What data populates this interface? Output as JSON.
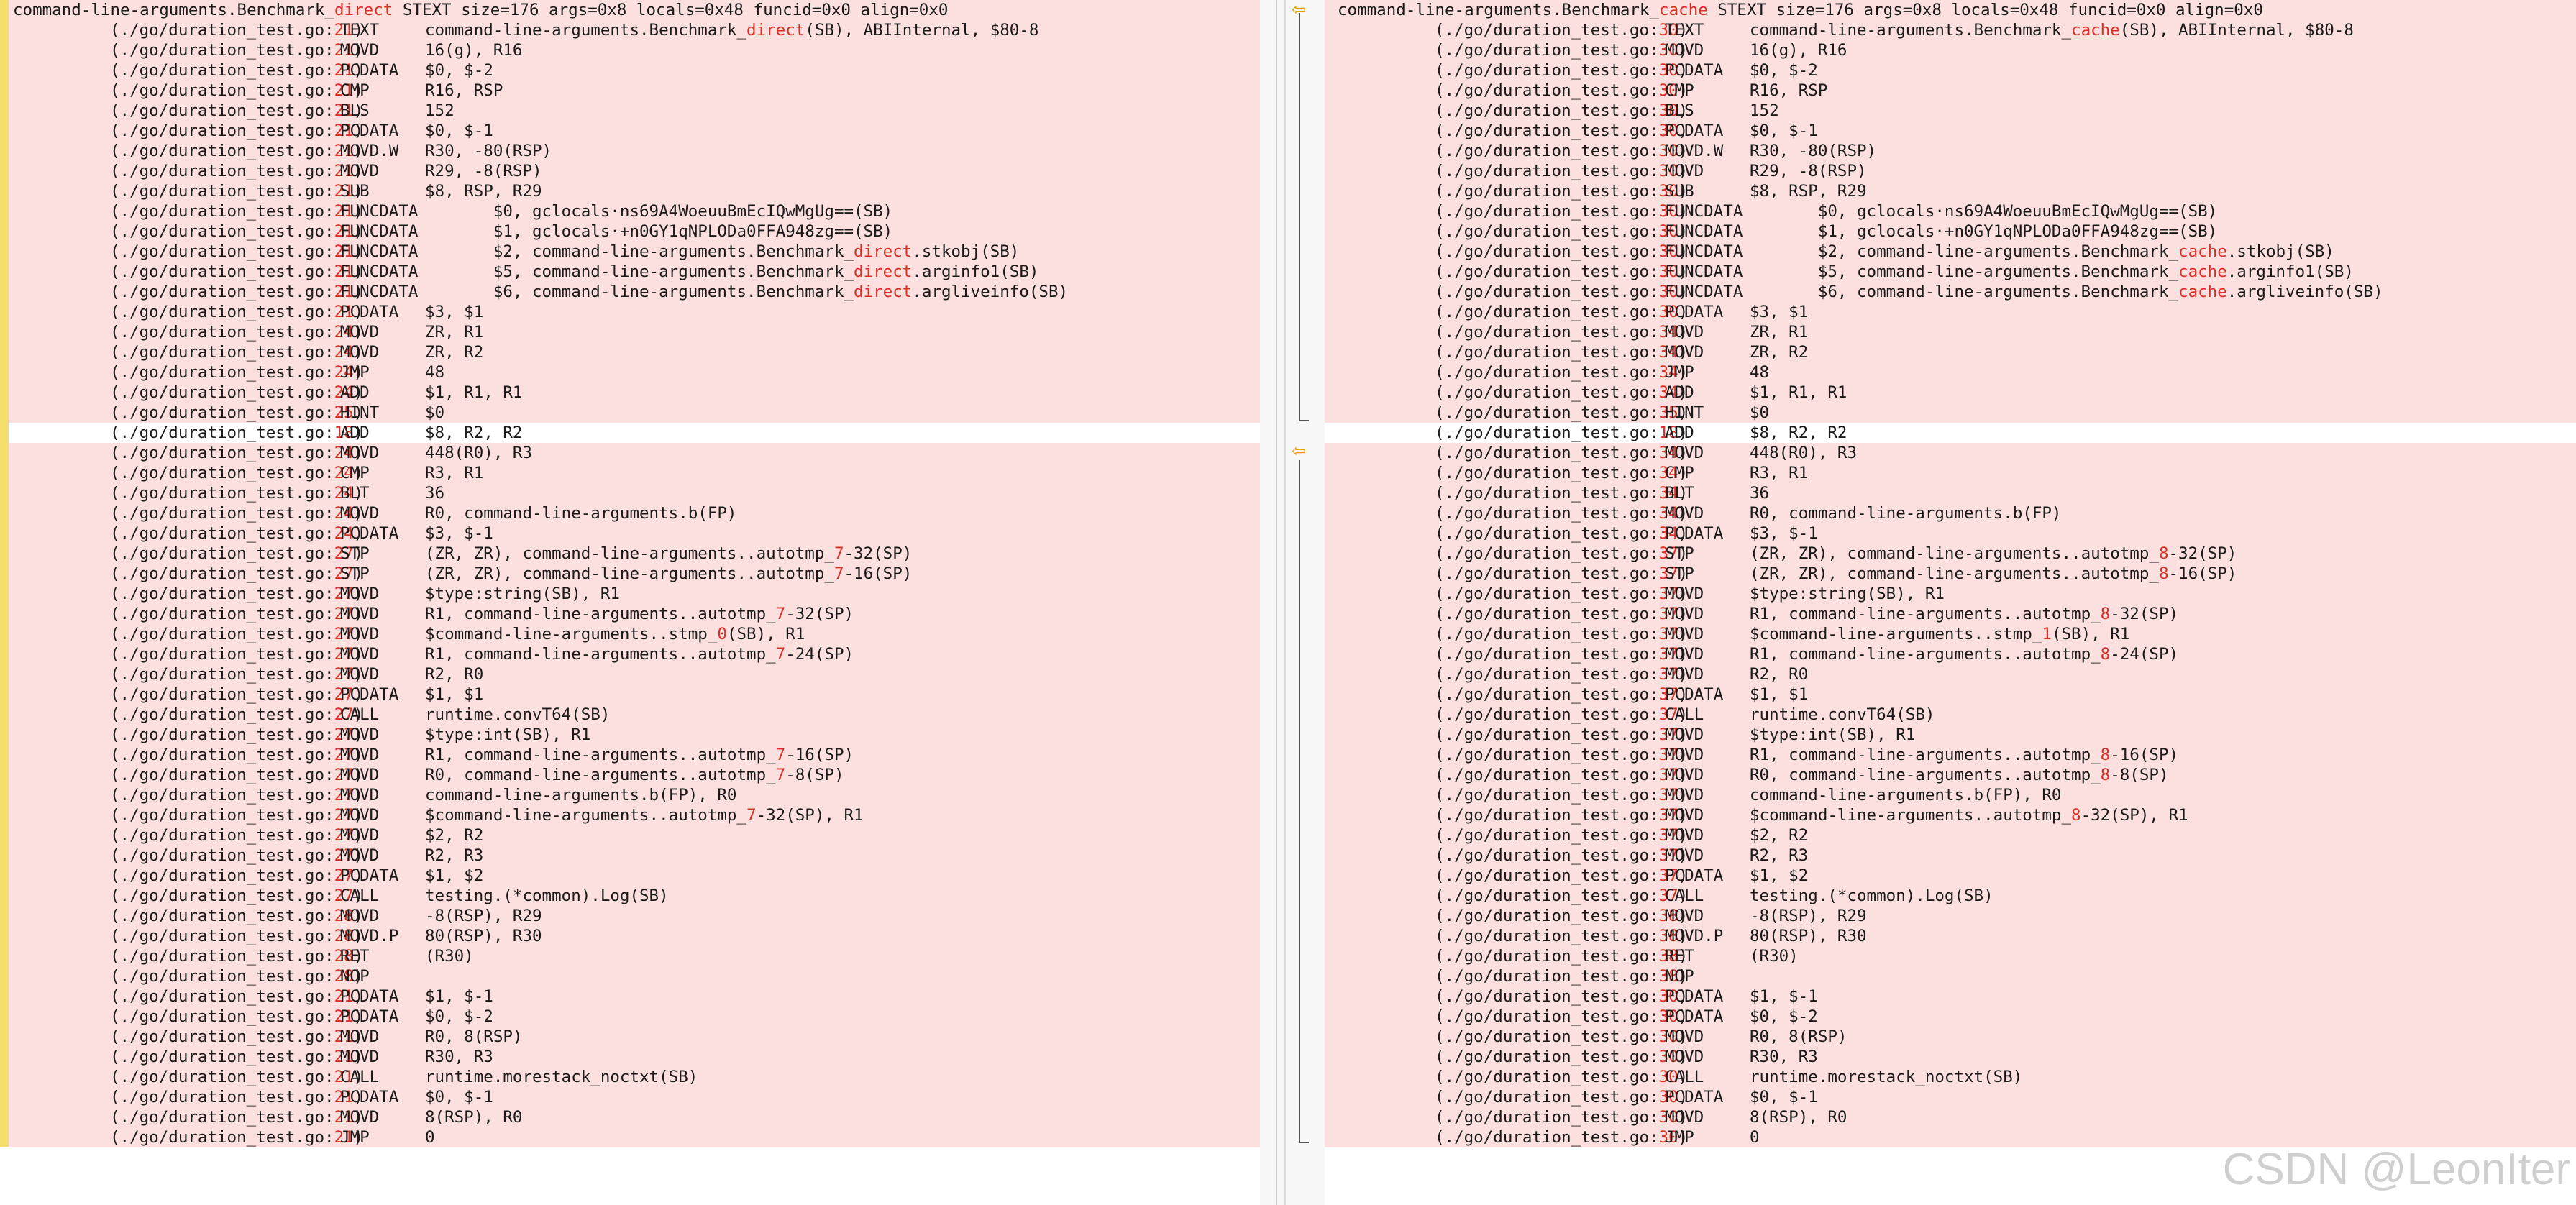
{
  "left": {
    "header_prefix": "command-line-arguments.Benchmark_",
    "header_name": "direct",
    "header_suffix": " STEXT size=176 args=0x8 locals=0x48 funcid=0x0 align=0x0",
    "lines": [
      [
        "21",
        "TEXT",
        "command-line-arguments.Benchmark_",
        "direct",
        "(SB), ABIInternal, $80-8"
      ],
      [
        "21",
        "MOVD",
        "16(g), R16",
        "",
        ""
      ],
      [
        "21",
        "PCDATA",
        "$0, $-2",
        "",
        ""
      ],
      [
        "21",
        "CMP",
        "R16, RSP",
        "",
        ""
      ],
      [
        "21",
        "BLS",
        "152",
        "",
        ""
      ],
      [
        "21",
        "PCDATA",
        "$0, $-1",
        "",
        ""
      ],
      [
        "21",
        "MOVD.W",
        "R30, -80(RSP)",
        "",
        ""
      ],
      [
        "21",
        "MOVD",
        "R29, -8(RSP)",
        "",
        ""
      ],
      [
        "21",
        "SUB",
        "$8, RSP, R29",
        "",
        ""
      ],
      [
        "21",
        "FUNCDATA",
        "       $0, gclocals·ns69A4WoeuuBmEcIQwMgUg==(SB)",
        "",
        ""
      ],
      [
        "21",
        "FUNCDATA",
        "       $1, gclocals·+n0GY1qNPLODa0FFA948zg==(SB)",
        "",
        ""
      ],
      [
        "21",
        "FUNCDATA",
        "       $2, command-line-arguments.Benchmark_",
        "direct",
        ".stkobj(SB)"
      ],
      [
        "21",
        "FUNCDATA",
        "       $5, command-line-arguments.Benchmark_",
        "direct",
        ".arginfo1(SB)"
      ],
      [
        "21",
        "FUNCDATA",
        "       $6, command-line-arguments.Benchmark_",
        "direct",
        ".argliveinfo(SB)"
      ],
      [
        "21",
        "PCDATA",
        "$3, $1",
        "",
        ""
      ],
      [
        "24",
        "MOVD",
        "ZR, R1",
        "",
        ""
      ],
      [
        "24",
        "MOVD",
        "ZR, R2",
        "",
        ""
      ],
      [
        "24",
        "JMP",
        "48",
        "",
        ""
      ],
      [
        "24",
        "ADD",
        "$1, R1, R1",
        "",
        ""
      ],
      [
        "25",
        "HINT",
        "$0",
        "",
        ""
      ],
      [
        "18",
        "ADD",
        "$8, R2, R2",
        "",
        ""
      ],
      [
        "24",
        "MOVD",
        "448(R0), R3",
        "",
        ""
      ],
      [
        "24",
        "CMP",
        "R3, R1",
        "",
        ""
      ],
      [
        "24",
        "BLT",
        "36",
        "",
        ""
      ],
      [
        "24",
        "MOVD",
        "R0, command-line-arguments.b(FP)",
        "",
        ""
      ],
      [
        "24",
        "PCDATA",
        "$3, $-1",
        "",
        ""
      ],
      [
        "27",
        "STP",
        "(ZR, ZR), command-line-arguments..autotmp_",
        "7",
        "-32(SP)"
      ],
      [
        "27",
        "STP",
        "(ZR, ZR), command-line-arguments..autotmp_",
        "7",
        "-16(SP)"
      ],
      [
        "27",
        "MOVD",
        "$type:string(SB), R1",
        "",
        ""
      ],
      [
        "27",
        "MOVD",
        "R1, command-line-arguments..autotmp_",
        "7",
        "-32(SP)"
      ],
      [
        "27",
        "MOVD",
        "$command-line-arguments..stmp_",
        "0",
        "(SB), R1"
      ],
      [
        "27",
        "MOVD",
        "R1, command-line-arguments..autotmp_",
        "7",
        "-24(SP)"
      ],
      [
        "27",
        "MOVD",
        "R2, R0",
        "",
        ""
      ],
      [
        "27",
        "PCDATA",
        "$1, $1",
        "",
        ""
      ],
      [
        "27",
        "CALL",
        "runtime.convT64(SB)",
        "",
        ""
      ],
      [
        "27",
        "MOVD",
        "$type:int(SB), R1",
        "",
        ""
      ],
      [
        "27",
        "MOVD",
        "R1, command-line-arguments..autotmp_",
        "7",
        "-16(SP)"
      ],
      [
        "27",
        "MOVD",
        "R0, command-line-arguments..autotmp_",
        "7",
        "-8(SP)"
      ],
      [
        "27",
        "MOVD",
        "command-line-arguments.b(FP), R0",
        "",
        ""
      ],
      [
        "27",
        "MOVD",
        "$command-line-arguments..autotmp_",
        "7",
        "-32(SP), R1"
      ],
      [
        "27",
        "MOVD",
        "$2, R2",
        "",
        ""
      ],
      [
        "27",
        "MOVD",
        "R2, R3",
        "",
        ""
      ],
      [
        "27",
        "PCDATA",
        "$1, $2",
        "",
        ""
      ],
      [
        "27",
        "CALL",
        "testing.(*common).Log(SB)",
        "",
        ""
      ],
      [
        "28",
        "MOVD",
        "-8(RSP), R29",
        "",
        ""
      ],
      [
        "28",
        "MOVD.P",
        "80(RSP), R30",
        "",
        ""
      ],
      [
        "28",
        "RET",
        "(R30)",
        "",
        ""
      ],
      [
        "28",
        "NOP",
        "",
        "",
        ""
      ],
      [
        "21",
        "PCDATA",
        "$1, $-1",
        "",
        ""
      ],
      [
        "21",
        "PCDATA",
        "$0, $-2",
        "",
        ""
      ],
      [
        "21",
        "MOVD",
        "R0, 8(RSP)",
        "",
        ""
      ],
      [
        "21",
        "MOVD",
        "R30, R3",
        "",
        ""
      ],
      [
        "21",
        "CALL",
        "runtime.morestack_noctxt(SB)",
        "",
        ""
      ],
      [
        "21",
        "PCDATA",
        "$0, $-1",
        "",
        ""
      ],
      [
        "21",
        "MOVD",
        "8(RSP), R0",
        "",
        ""
      ],
      [
        "21",
        "JMP",
        "0",
        "",
        ""
      ]
    ]
  },
  "right": {
    "header_prefix": "command-line-arguments.Benchmark_",
    "header_name": "cache",
    "header_suffix": " STEXT size=176 args=0x8 locals=0x48 funcid=0x0 align=0x0",
    "lines": [
      [
        "30",
        "TEXT",
        "command-line-arguments.Benchmark_",
        "cache",
        "(SB), ABIInternal, $80-8"
      ],
      [
        "30",
        "MOVD",
        "16(g), R16",
        "",
        ""
      ],
      [
        "30",
        "PCDATA",
        "$0, $-2",
        "",
        ""
      ],
      [
        "30",
        "CMP",
        "R16, RSP",
        "",
        ""
      ],
      [
        "30",
        "BLS",
        "152",
        "",
        ""
      ],
      [
        "30",
        "PCDATA",
        "$0, $-1",
        "",
        ""
      ],
      [
        "30",
        "MOVD.W",
        "R30, -80(RSP)",
        "",
        ""
      ],
      [
        "30",
        "MOVD",
        "R29, -8(RSP)",
        "",
        ""
      ],
      [
        "30",
        "SUB",
        "$8, RSP, R29",
        "",
        ""
      ],
      [
        "30",
        "FUNCDATA",
        "       $0, gclocals·ns69A4WoeuuBmEcIQwMgUg==(SB)",
        "",
        ""
      ],
      [
        "30",
        "FUNCDATA",
        "       $1, gclocals·+n0GY1qNPLODa0FFA948zg==(SB)",
        "",
        ""
      ],
      [
        "30",
        "FUNCDATA",
        "       $2, command-line-arguments.Benchmark_",
        "cache",
        ".stkobj(SB)"
      ],
      [
        "30",
        "FUNCDATA",
        "       $5, command-line-arguments.Benchmark_",
        "cache",
        ".arginfo1(SB)"
      ],
      [
        "30",
        "FUNCDATA",
        "       $6, command-line-arguments.Benchmark_",
        "cache",
        ".argliveinfo(SB)"
      ],
      [
        "30",
        "PCDATA",
        "$3, $1",
        "",
        ""
      ],
      [
        "34",
        "MOVD",
        "ZR, R1",
        "",
        ""
      ],
      [
        "34",
        "MOVD",
        "ZR, R2",
        "",
        ""
      ],
      [
        "34",
        "JMP",
        "48",
        "",
        ""
      ],
      [
        "34",
        "ADD",
        "$1, R1, R1",
        "",
        ""
      ],
      [
        "35",
        "HINT",
        "$0",
        "",
        ""
      ],
      [
        "18",
        "ADD",
        "$8, R2, R2",
        "",
        ""
      ],
      [
        "34",
        "MOVD",
        "448(R0), R3",
        "",
        ""
      ],
      [
        "34",
        "CMP",
        "R3, R1",
        "",
        ""
      ],
      [
        "34",
        "BLT",
        "36",
        "",
        ""
      ],
      [
        "34",
        "MOVD",
        "R0, command-line-arguments.b(FP)",
        "",
        ""
      ],
      [
        "34",
        "PCDATA",
        "$3, $-1",
        "",
        ""
      ],
      [
        "37",
        "STP",
        "(ZR, ZR), command-line-arguments..autotmp_",
        "8",
        "-32(SP)"
      ],
      [
        "37",
        "STP",
        "(ZR, ZR), command-line-arguments..autotmp_",
        "8",
        "-16(SP)"
      ],
      [
        "37",
        "MOVD",
        "$type:string(SB), R1",
        "",
        ""
      ],
      [
        "37",
        "MOVD",
        "R1, command-line-arguments..autotmp_",
        "8",
        "-32(SP)"
      ],
      [
        "37",
        "MOVD",
        "$command-line-arguments..stmp_",
        "1",
        "(SB), R1"
      ],
      [
        "37",
        "MOVD",
        "R1, command-line-arguments..autotmp_",
        "8",
        "-24(SP)"
      ],
      [
        "37",
        "MOVD",
        "R2, R0",
        "",
        ""
      ],
      [
        "37",
        "PCDATA",
        "$1, $1",
        "",
        ""
      ],
      [
        "37",
        "CALL",
        "runtime.convT64(SB)",
        "",
        ""
      ],
      [
        "37",
        "MOVD",
        "$type:int(SB), R1",
        "",
        ""
      ],
      [
        "37",
        "MOVD",
        "R1, command-line-arguments..autotmp_",
        "8",
        "-16(SP)"
      ],
      [
        "37",
        "MOVD",
        "R0, command-line-arguments..autotmp_",
        "8",
        "-8(SP)"
      ],
      [
        "37",
        "MOVD",
        "command-line-arguments.b(FP), R0",
        "",
        ""
      ],
      [
        "37",
        "MOVD",
        "$command-line-arguments..autotmp_",
        "8",
        "-32(SP), R1"
      ],
      [
        "37",
        "MOVD",
        "$2, R2",
        "",
        ""
      ],
      [
        "37",
        "MOVD",
        "R2, R3",
        "",
        ""
      ],
      [
        "37",
        "PCDATA",
        "$1, $2",
        "",
        ""
      ],
      [
        "37",
        "CALL",
        "testing.(*common).Log(SB)",
        "",
        ""
      ],
      [
        "38",
        "MOVD",
        "-8(RSP), R29",
        "",
        ""
      ],
      [
        "38",
        "MOVD.P",
        "80(RSP), R30",
        "",
        ""
      ],
      [
        "38",
        "RET",
        "(R30)",
        "",
        ""
      ],
      [
        "38",
        "NOP",
        "",
        "",
        ""
      ],
      [
        "30",
        "PCDATA",
        "$1, $-1",
        "",
        ""
      ],
      [
        "30",
        "PCDATA",
        "$0, $-2",
        "",
        ""
      ],
      [
        "30",
        "MOVD",
        "R0, 8(RSP)",
        "",
        ""
      ],
      [
        "30",
        "MOVD",
        "R30, R3",
        "",
        ""
      ],
      [
        "30",
        "CALL",
        "runtime.morestack_noctxt(SB)",
        "",
        ""
      ],
      [
        "30",
        "PCDATA",
        "$0, $-1",
        "",
        ""
      ],
      [
        "30",
        "MOVD",
        "8(RSP), R0",
        "",
        ""
      ],
      [
        "30",
        "JMP",
        "0",
        "",
        ""
      ]
    ]
  },
  "path_prefix": "(./go/duration_test.go:",
  "path_suffix": ")",
  "watermark": "CSDN @LeonIter",
  "icons": {
    "prev_change": "arrow-left-icon",
    "next_change": "arrow-left-icon"
  },
  "colors": {
    "diff_background": "#fce0df",
    "accent_bar": "#f3de6b",
    "changed_token": "#d93025"
  }
}
